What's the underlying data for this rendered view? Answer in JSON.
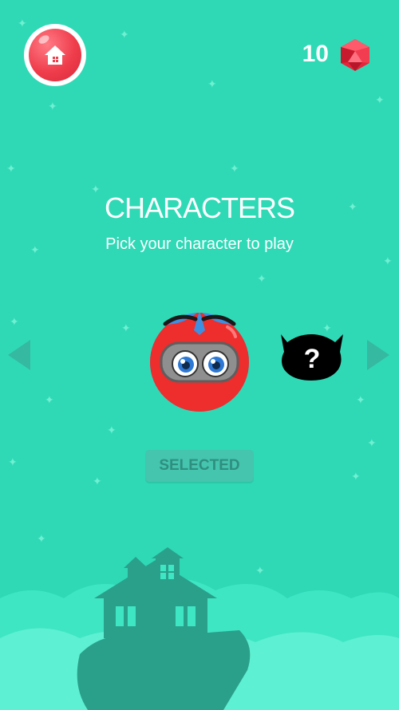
{
  "header": {
    "gem_count": "10",
    "home_icon": "house-icon",
    "gem_icon": "red-gem-icon"
  },
  "screen": {
    "title": "CHARACTERS",
    "subtitle": "Pick your character to play"
  },
  "carousel": {
    "prev_icon": "triangle-left-icon",
    "next_icon": "triangle-right-icon",
    "selected_character": "masked-ball-character",
    "locked_character": "locked-character-silhouette",
    "locked_glyph": "?"
  },
  "actions": {
    "selected_label": "SELECTED"
  },
  "colors": {
    "background": "#2fd9b6",
    "accent_red": "#ef3d4c",
    "button": "#45c4ae",
    "scenery": "#2aa08b"
  }
}
